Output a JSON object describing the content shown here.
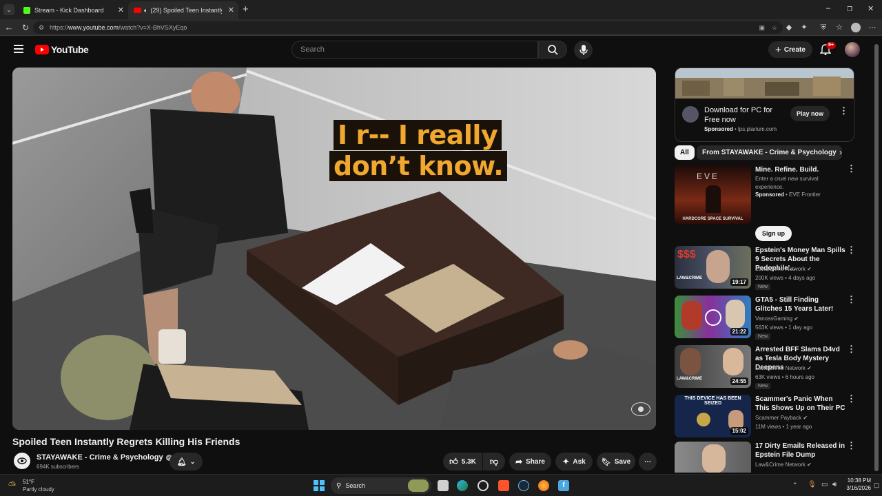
{
  "browser": {
    "tabs": [
      {
        "label": "Stream - Kick Dashboard",
        "icon": "kick-icon"
      },
      {
        "label": "(29) Spoiled Teen Instantly Re",
        "icon": "youtube-icon"
      }
    ],
    "url_prefix": "https://",
    "url_host": "www.youtube.com",
    "url_path": "/watch?v=X-BhVSXyEqo"
  },
  "youtube": {
    "logo": "YouTube",
    "search_placeholder": "Search",
    "create_label": "Create",
    "notification_count": "9+"
  },
  "video": {
    "caption_line1": "I r-- I really",
    "caption_line2": "don’t know.",
    "title": "Spoiled Teen Instantly Regrets Killing His Friends",
    "channel": "STAYAWAKE - Crime & Psychology",
    "subscribers": "694K subscribers",
    "likes": "5.3K",
    "share_label": "Share",
    "ask_label": "Ask",
    "save_label": "Save"
  },
  "ad": {
    "title": "Download for PC for Free now",
    "sponsored": "Sponsored",
    "domain": "lps.plarium.com",
    "cta": "Play now"
  },
  "chips": [
    "All",
    "From STAYAWAKE - Crime & Psychology"
  ],
  "sponsored_rec": {
    "title": "Mine. Refine. Build.",
    "desc": "Enter a cruel new survival experience.",
    "sponsored": "Sponsored",
    "advertiser": "EVE Frontier",
    "cta": "Sign up",
    "thumb_text": "HARDCORE SPACE SURVIVAL"
  },
  "recommendations": [
    {
      "title": "Epstein's Money Man Spills 9 Secrets About the Pedophile'...",
      "channel": "Law&Crime Network",
      "meta": "200K views • 4 days ago",
      "duration": "19:17",
      "badge": "New",
      "color": "#3a3f52"
    },
    {
      "title": "GTA5 - Still Finding Glitches 15 Years Later!",
      "channel": "VanossGaming",
      "meta": "563K views • 1 day ago",
      "duration": "21:22",
      "badge": "New",
      "color": "#7b2f8a"
    },
    {
      "title": "Arrested BFF Slams D4vd as Tesla Body Mystery Deepens",
      "channel": "Law&Crime Network",
      "meta": "63K views • 6 hours ago",
      "duration": "24:55",
      "badge": "New",
      "color": "#4a4a4a"
    },
    {
      "title": "Scammer's Panic When This Shows Up on Their PC",
      "channel": "Scammer Payback",
      "meta": "11M views • 1 year ago",
      "duration": "15:02",
      "badge": "",
      "color": "#15264a"
    },
    {
      "title": "17 Dirty Emails Released in Epstein File Dump",
      "channel": "Law&Crime Network",
      "meta": "",
      "duration": "",
      "badge": "",
      "color": "#6a6a6a"
    }
  ],
  "rec_thumb_labels": {
    "law_crime": "LAW&CRIME",
    "device_seized": "THIS DEVICE HAS BEEN SEIZED",
    "dollars": "$$$"
  },
  "taskbar": {
    "weather_temp": "51°F",
    "weather_desc": "Partly cloudy",
    "search_label": "Search",
    "time": "10:38 PM",
    "date": "3/16/2026"
  }
}
